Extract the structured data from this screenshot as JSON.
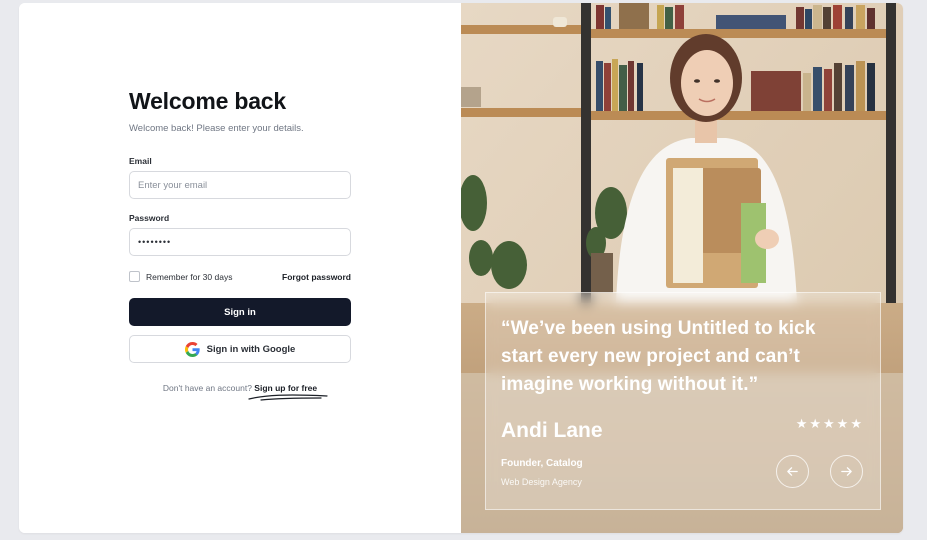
{
  "login": {
    "title": "Welcome back",
    "subtitle": "Welcome back! Please enter your details.",
    "email_label": "Email",
    "email_placeholder": "Enter your email",
    "password_label": "Password",
    "password_value": "••••••••",
    "remember_label": "Remember for 30 days",
    "forgot_label": "Forgot password",
    "signin_label": "Sign in",
    "google_label": "Sign in with Google",
    "no_account_text": "Don't have an account?",
    "signup_label": "Sign up for free"
  },
  "testimonial": {
    "quote": "“We’ve been using Untitled to kick start every new project and can’t imagine working without it.”",
    "author": "Andi Lane",
    "role": "Founder, Catalog",
    "company": "Web Design Agency",
    "stars": "★★★★★",
    "rating": 5
  },
  "icons": {
    "google": "google-icon",
    "prev": "arrow-left-icon",
    "next": "arrow-right-icon",
    "star": "star-icon"
  },
  "colors": {
    "primary_button": "#13192a",
    "text_dark": "#111418",
    "text_muted": "#707784",
    "border": "#d7d9de"
  }
}
